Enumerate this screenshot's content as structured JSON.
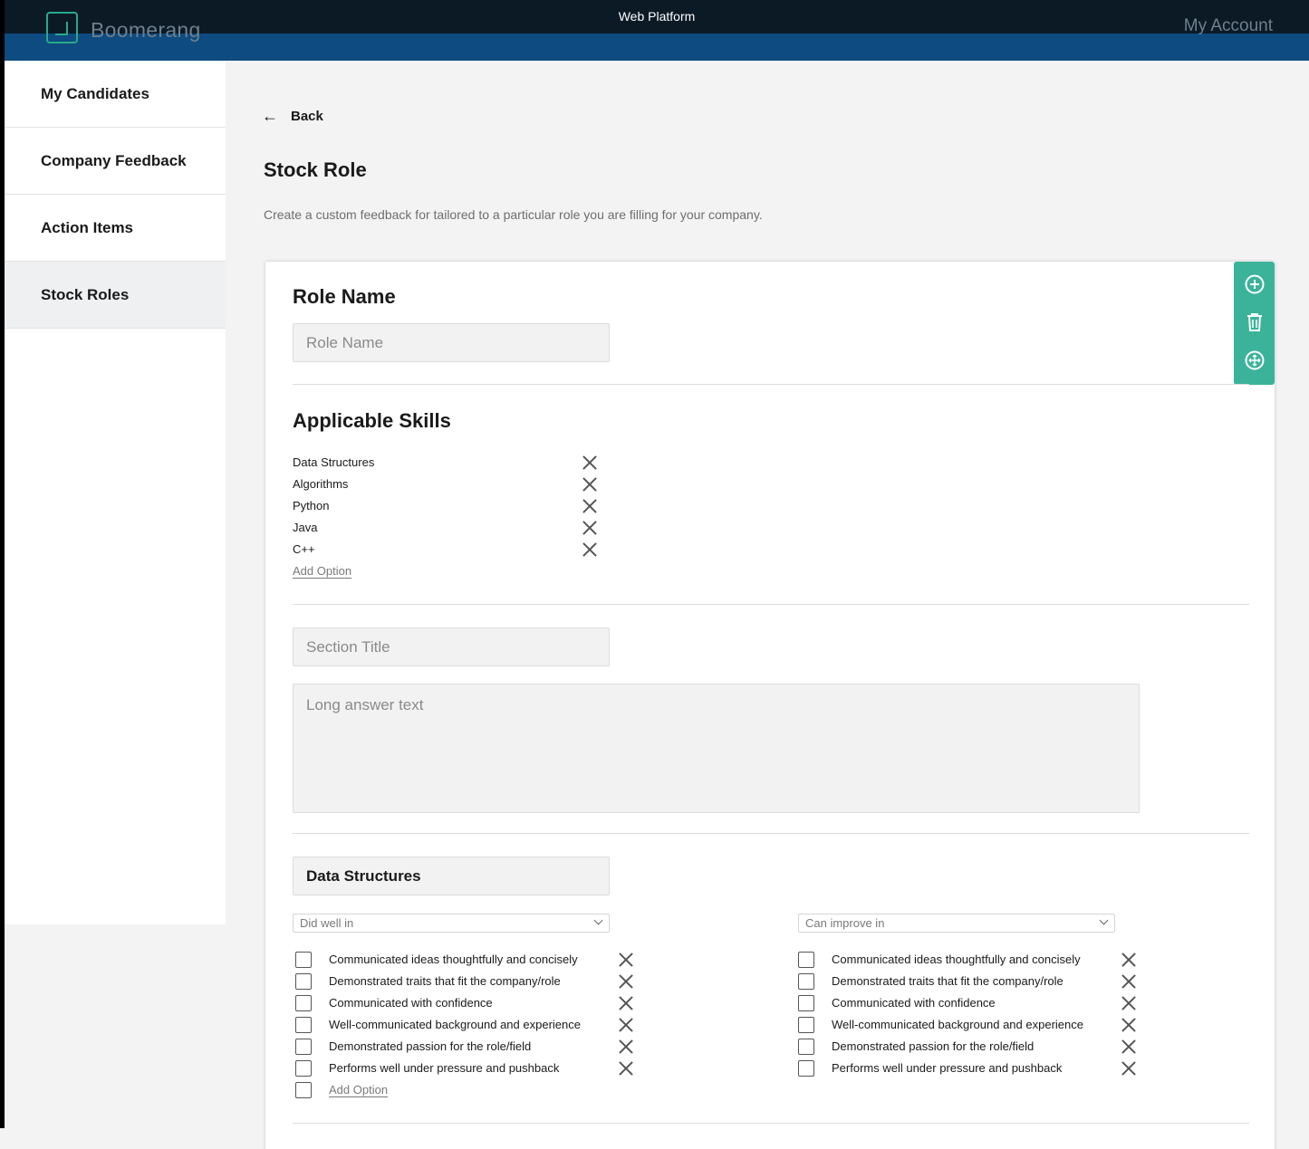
{
  "topbar": {
    "platform": "Web Platform",
    "brand": "Boomerang",
    "account": "My Account"
  },
  "sidebar": {
    "items": [
      {
        "label": "My Candidates"
      },
      {
        "label": "Company Feedback"
      },
      {
        "label": "Action Items"
      },
      {
        "label": "Stock Roles",
        "active": true
      }
    ]
  },
  "header": {
    "back": "Back",
    "title": "Stock Role",
    "description": "Create a custom feedback for tailored to a particular role you are filling for your company."
  },
  "toolbar": {
    "icons": [
      "add-circle-icon",
      "trash-icon",
      "move-icon"
    ]
  },
  "role": {
    "heading": "Role Name",
    "placeholder": "Role Name"
  },
  "skills": {
    "heading": "Applicable Skills",
    "items": [
      "Data Structures",
      "Algorithms",
      "Python",
      "Java",
      "C++"
    ],
    "add_option": "Add Option"
  },
  "section": {
    "title_placeholder": "Section Title",
    "answer_placeholder": "Long answer text"
  },
  "skill_block": {
    "title": "Data Structures",
    "did_well": {
      "select": "Did well in",
      "options": [
        "Communicated ideas thoughtfully and concisely",
        "Demonstrated traits that fit the company/role",
        "Communicated with confidence",
        "Well-communicated background and experience",
        "Demonstrated passion for the role/field",
        "Performs well under pressure and pushback"
      ],
      "add_option": "Add Option"
    },
    "can_improve": {
      "select": "Can improve in",
      "options": [
        "Communicated ideas thoughtfully and concisely",
        "Demonstrated traits that fit the company/role",
        "Communicated with confidence",
        "Well-communicated background and experience",
        "Demonstrated passion for the role/field",
        "Performs well under pressure and pushback"
      ]
    }
  },
  "colors": {
    "accent": "#3bb39a",
    "topbar_dark": "#0c1a26",
    "topbar_blue": "#0d4b80"
  }
}
